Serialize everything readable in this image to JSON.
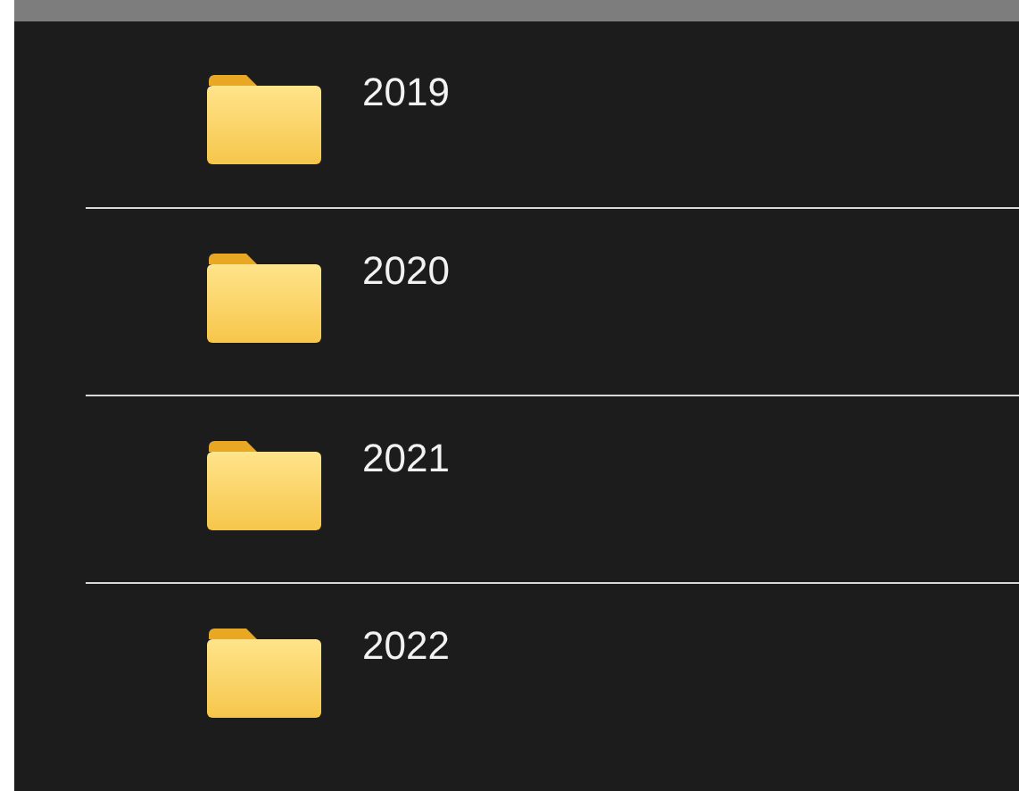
{
  "folders": [
    {
      "name": "2019"
    },
    {
      "name": "2020"
    },
    {
      "name": "2021"
    },
    {
      "name": "2022"
    }
  ]
}
